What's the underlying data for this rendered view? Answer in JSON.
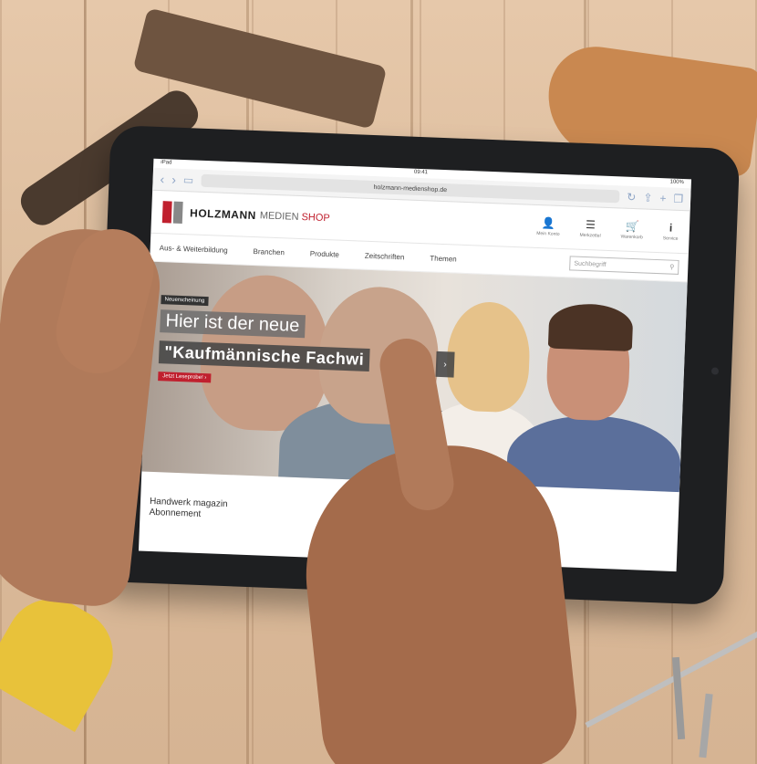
{
  "browser": {
    "status_left": "iPad",
    "time": "09:41",
    "status_right": "100%",
    "url": "holzmann-medienshop.de"
  },
  "site": {
    "logo_main": "HOLZMANN",
    "logo_sub": "MEDIEN",
    "logo_shop": "SHOP",
    "header_icons": [
      {
        "icon": "user-icon",
        "glyph": "👤",
        "label": "Mein Konto"
      },
      {
        "icon": "list-icon",
        "glyph": "☰",
        "label": "Merkzettel"
      },
      {
        "icon": "cart-icon",
        "glyph": "🛒",
        "label": "Warenkorb"
      },
      {
        "icon": "info-icon",
        "glyph": "i",
        "label": "Service"
      }
    ],
    "nav": [
      "Aus- & Weiterbildung",
      "Branchen",
      "Produkte",
      "Zeitschriften",
      "Themen"
    ],
    "search_placeholder": "Suchbegriff"
  },
  "hero": {
    "tag": "Neuerscheinung",
    "line1": "Hier ist der neue",
    "line2": "\"Kaufmännische Fachwi",
    "cta": "Jetzt Leseprobe! ›",
    "next": "›"
  },
  "teaser": {
    "line1": "Handwerk magazin",
    "line2": "Abonnement"
  }
}
